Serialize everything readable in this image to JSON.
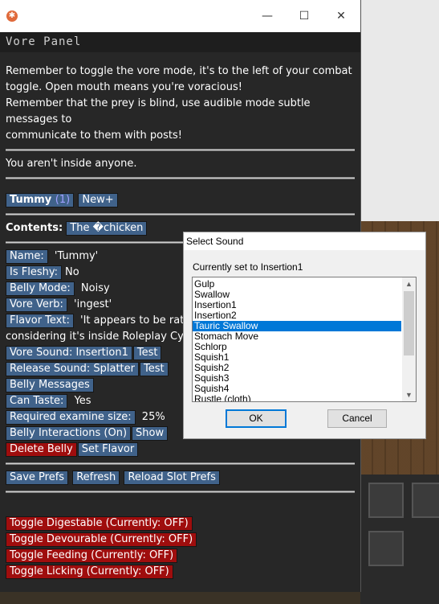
{
  "window": {
    "panel_title": "Vore Panel",
    "controls": {
      "minimize": "—",
      "maximize": "☐",
      "close": "✕"
    }
  },
  "intro": [
    "Remember to toggle the vore mode, it's to the left of your combat",
    "toggle. Open mouth means you're voracious!",
    "Remember that the prey is blind, use audible mode subtle messages to",
    "communicate to them with posts!"
  ],
  "location": "You aren't inside anyone.",
  "bellies": {
    "tab_label": "Tummy",
    "tab_count": "(1)",
    "new_label": "New+"
  },
  "contents": {
    "label": "Contents:",
    "item": "The �chicken"
  },
  "belly": {
    "name_label": "Name:",
    "name_value": "'Tummy'",
    "fleshy_label": "Is Fleshy:",
    "fleshy_value": "No",
    "mode_label": "Belly Mode:",
    "mode_value": "Noisy",
    "verb_label": "Vore Verb:",
    "verb_value": "'ingest'",
    "flavor_label": "Flavor Text:",
    "flavor_value": "'It appears to be rathe",
    "flavor_cont": "considering it's inside Roleplay Cybo",
    "vore_sound": "Vore Sound: Insertion1",
    "test1": "Test",
    "release_sound": "Release Sound: Splatter",
    "test2": "Test",
    "messages": "Belly Messages",
    "taste_label": "Can Taste:",
    "taste_value": "Yes",
    "exam_label": "Required examine size:",
    "exam_value": "25%",
    "interactions": "Belly Interactions (On)",
    "show": "Show",
    "delete": "Delete Belly",
    "set_flavor": "Set Flavor"
  },
  "prefs": {
    "save": "Save Prefs",
    "refresh": "Refresh",
    "reload": "Reload Slot Prefs"
  },
  "toggles": [
    "Toggle Digestable (Currently: OFF)",
    "Toggle Devourable (Currently: OFF)",
    "Toggle Feeding (Currently: OFF)",
    "Toggle Licking (Currently: OFF)"
  ],
  "dialog": {
    "title": "Select Sound",
    "current": "Currently set to Insertion1",
    "options": [
      "Gulp",
      "Swallow",
      "Insertion1",
      "Insertion2",
      "Tauric Swallow",
      "Stomach Move",
      "Schlorp",
      "Squish1",
      "Squish2",
      "Squish3",
      "Squish4",
      "Rustle (cloth)"
    ],
    "selected_index": 4,
    "ok": "OK",
    "cancel": "Cancel"
  },
  "colors": {
    "button_blue": "#40628a",
    "button_red": "#9f0d0d",
    "panel_bg": "#272727",
    "selection": "#0078d7"
  }
}
